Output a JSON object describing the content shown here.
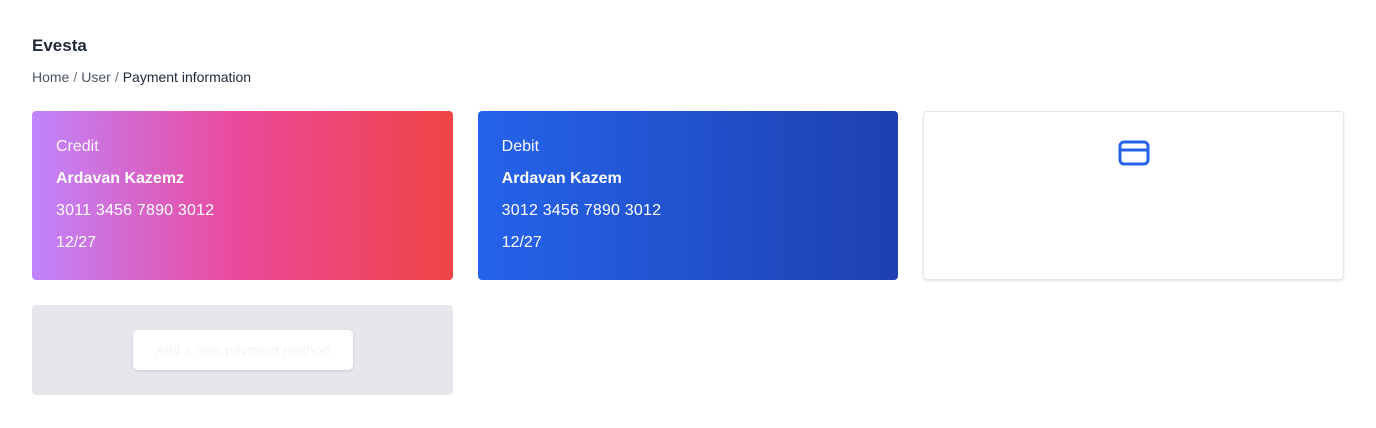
{
  "header": {
    "brand": "Evesta"
  },
  "breadcrumb": {
    "items": [
      "Home",
      "User"
    ],
    "separator": "/",
    "current": "Payment information"
  },
  "cards": [
    {
      "type": "Credit",
      "holder": "Ardavan Kazemz",
      "number": "3011 3456 7890 3012",
      "expiry": "12/27"
    },
    {
      "type": "Debit",
      "holder": "Ardavan Kazem",
      "number": "3012 3456 7890 3012",
      "expiry": "12/27"
    }
  ],
  "empty_card": {
    "icon": "credit-card-icon",
    "icon_color": "#2563eb"
  },
  "add_panel": {
    "button_label": "Add a new payment method"
  },
  "colors": {
    "credit_gradient": [
      "#c084fc",
      "#ec4899",
      "#ef4444"
    ],
    "debit_gradient": [
      "#2563eb",
      "#1e40af"
    ],
    "panel_bg": "#e5e7eb"
  }
}
